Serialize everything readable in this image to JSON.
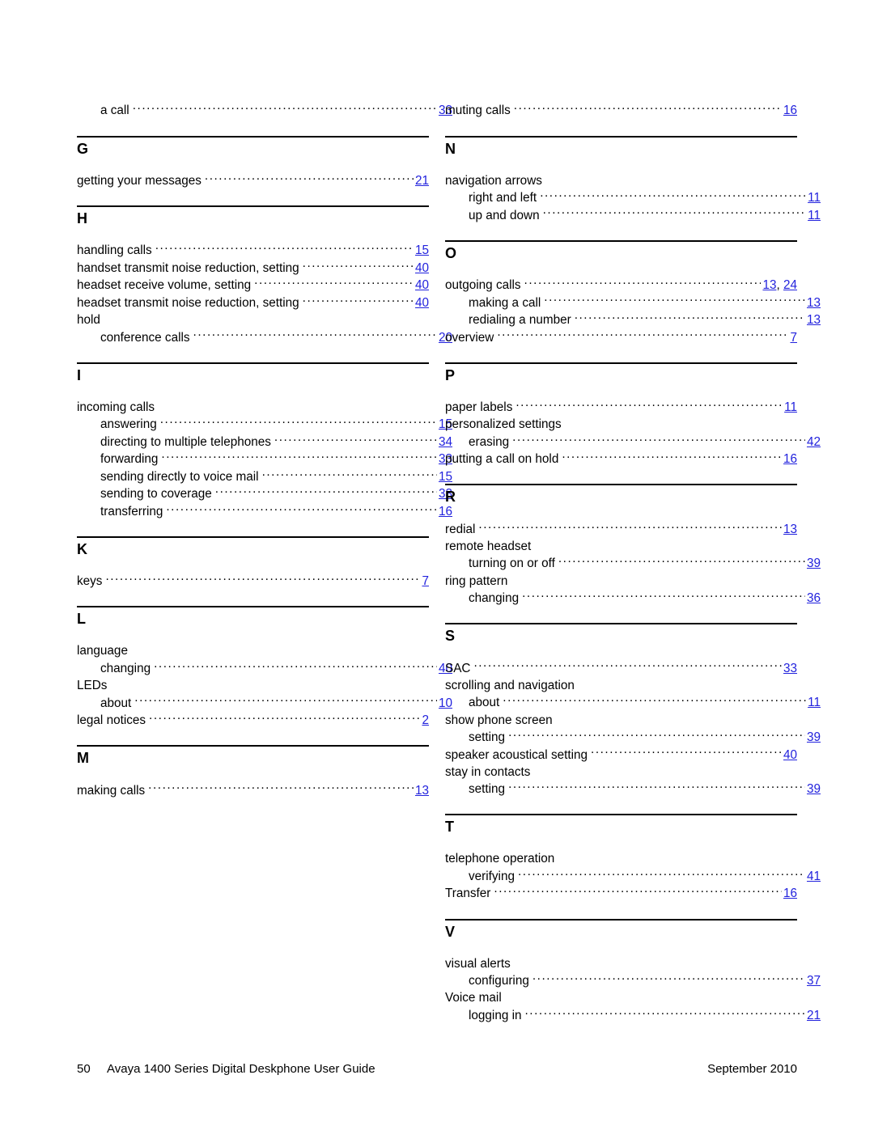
{
  "document": {
    "type": "index",
    "page_number": "50",
    "footer_title": "Avaya 1400 Series Digital Deskphone User Guide",
    "footer_date": "September 2010",
    "link_color": "#2222dd"
  },
  "columns": [
    {
      "name": "left-column",
      "leading_entries": [
        {
          "label": "a call",
          "level": "sub",
          "pages": [
            "33"
          ]
        }
      ],
      "sections": [
        {
          "letter": "G",
          "entries": [
            {
              "label": "getting your messages",
              "level": "main",
              "pages": [
                "21"
              ]
            }
          ]
        },
        {
          "letter": "H",
          "entries": [
            {
              "label": "handling calls",
              "level": "main",
              "pages": [
                "15"
              ]
            },
            {
              "label": "handset transmit noise reduction, setting",
              "level": "main",
              "pages": [
                "40"
              ]
            },
            {
              "label": "headset receive volume, setting",
              "level": "main",
              "pages": [
                "40"
              ]
            },
            {
              "label": "headset transmit noise reduction, setting",
              "level": "main",
              "pages": [
                "40"
              ]
            },
            {
              "label": "hold",
              "level": "main",
              "pages": []
            },
            {
              "label": "conference calls",
              "level": "sub",
              "pages": [
                "20"
              ]
            }
          ]
        },
        {
          "letter": "I",
          "entries": [
            {
              "label": "incoming calls",
              "level": "main",
              "pages": []
            },
            {
              "label": "answering",
              "level": "sub",
              "pages": [
                "15"
              ]
            },
            {
              "label": "directing to multiple telephones",
              "level": "sub",
              "pages": [
                "34"
              ]
            },
            {
              "label": "forwarding",
              "level": "sub",
              "pages": [
                "33"
              ]
            },
            {
              "label": "sending directly to voice mail",
              "level": "sub",
              "pages": [
                "15"
              ]
            },
            {
              "label": "sending to coverage",
              "level": "sub",
              "pages": [
                "33"
              ]
            },
            {
              "label": "transferring",
              "level": "sub",
              "pages": [
                "16"
              ]
            }
          ]
        },
        {
          "letter": "K",
          "entries": [
            {
              "label": "keys",
              "level": "main",
              "pages": [
                "7"
              ]
            }
          ]
        },
        {
          "letter": "L",
          "entries": [
            {
              "label": "language",
              "level": "main",
              "pages": []
            },
            {
              "label": "changing",
              "level": "sub",
              "pages": [
                "40"
              ]
            },
            {
              "label": "LEDs",
              "level": "main",
              "pages": []
            },
            {
              "label": "about",
              "level": "sub",
              "pages": [
                "10"
              ]
            },
            {
              "label": "legal notices",
              "level": "main",
              "pages": [
                "2"
              ]
            }
          ]
        },
        {
          "letter": "M",
          "entries": [
            {
              "label": "making calls",
              "level": "main",
              "pages": [
                "13"
              ]
            }
          ]
        }
      ]
    },
    {
      "name": "right-column",
      "leading_entries": [
        {
          "label": "muting calls",
          "level": "main",
          "pages": [
            "16"
          ]
        }
      ],
      "sections": [
        {
          "letter": "N",
          "entries": [
            {
              "label": "navigation arrows",
              "level": "main",
              "pages": []
            },
            {
              "label": "right and left",
              "level": "sub",
              "pages": [
                "11"
              ]
            },
            {
              "label": "up and down",
              "level": "sub",
              "pages": [
                "11"
              ]
            }
          ]
        },
        {
          "letter": "O",
          "entries": [
            {
              "label": "outgoing calls",
              "level": "main",
              "pages": [
                "13",
                "24"
              ]
            },
            {
              "label": "making a call",
              "level": "sub",
              "pages": [
                "13"
              ]
            },
            {
              "label": "redialing a number",
              "level": "sub",
              "pages": [
                "13"
              ]
            },
            {
              "label": "overview",
              "level": "main",
              "pages": [
                "7"
              ]
            }
          ]
        },
        {
          "letter": "P",
          "entries": [
            {
              "label": "paper labels",
              "level": "main",
              "pages": [
                "11"
              ]
            },
            {
              "label": "personalized settings",
              "level": "main",
              "pages": []
            },
            {
              "label": "erasing",
              "level": "sub",
              "pages": [
                "42"
              ]
            },
            {
              "label": "putting a call on hold",
              "level": "main",
              "pages": [
                "16"
              ]
            }
          ]
        },
        {
          "letter": "R",
          "entries": [
            {
              "label": "redial",
              "level": "main",
              "pages": [
                "13"
              ]
            },
            {
              "label": "remote headset",
              "level": "main",
              "pages": []
            },
            {
              "label": "turning on or off",
              "level": "sub",
              "pages": [
                "39"
              ]
            },
            {
              "label": "ring pattern",
              "level": "main",
              "pages": []
            },
            {
              "label": "changing",
              "level": "sub",
              "pages": [
                "36"
              ]
            }
          ]
        },
        {
          "letter": "S",
          "entries": [
            {
              "label": "SAC",
              "level": "main",
              "pages": [
                "33"
              ]
            },
            {
              "label": "scrolling and navigation",
              "level": "main",
              "pages": []
            },
            {
              "label": "about",
              "level": "sub",
              "pages": [
                "11"
              ]
            },
            {
              "label": "show phone screen",
              "level": "main",
              "pages": []
            },
            {
              "label": "setting",
              "level": "sub",
              "pages": [
                "39"
              ]
            },
            {
              "label": "speaker acoustical setting",
              "level": "main",
              "pages": [
                "40"
              ]
            },
            {
              "label": "stay in contacts",
              "level": "main",
              "pages": []
            },
            {
              "label": "setting",
              "level": "sub",
              "pages": [
                "39"
              ]
            }
          ]
        },
        {
          "letter": "T",
          "entries": [
            {
              "label": "telephone operation",
              "level": "main",
              "pages": []
            },
            {
              "label": "verifying",
              "level": "sub",
              "pages": [
                "41"
              ]
            },
            {
              "label": "Transfer",
              "level": "main",
              "pages": [
                "16"
              ]
            }
          ]
        },
        {
          "letter": "V",
          "entries": [
            {
              "label": "visual alerts",
              "level": "main",
              "pages": []
            },
            {
              "label": "configuring",
              "level": "sub",
              "pages": [
                "37"
              ]
            },
            {
              "label": "Voice mail",
              "level": "main",
              "pages": []
            },
            {
              "label": "logging in",
              "level": "sub",
              "pages": [
                "21"
              ]
            }
          ]
        }
      ]
    }
  ]
}
